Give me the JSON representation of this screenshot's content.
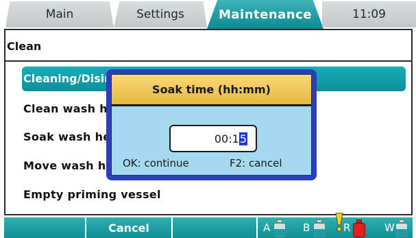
{
  "tabs": {
    "main": "Main",
    "settings": "Settings",
    "maintenance": "Maintenance",
    "time": "11:09"
  },
  "panel": {
    "title": "Clean",
    "items": [
      "Cleaning/Disinfection",
      "Clean wash head",
      "Soak wash head",
      "Move wash head",
      "Empty priming vessel"
    ],
    "selected_index": 0
  },
  "dialog": {
    "title": "Soak time (hh:mm)",
    "value_prefix": "00:1",
    "value_cursor": "5",
    "ok_hint": "OK: continue",
    "cancel_hint": "F2: cancel"
  },
  "bottombar": {
    "softkey1": "",
    "softkey2": "Cancel",
    "softkey3": "",
    "bottles": [
      {
        "label": "A",
        "state": "ok"
      },
      {
        "label": "B",
        "state": "ok"
      },
      {
        "label": "R",
        "state": "warning"
      },
      {
        "label": "W",
        "state": "ok"
      }
    ]
  },
  "colors": {
    "accent_teal": "#0e8a90",
    "dialog_border": "#2a3fb8",
    "dialog_title": "#e8b840",
    "dialog_body": "#a6d8f0",
    "warning_red": "#e02020",
    "warning_yellow": "#f0d020"
  }
}
